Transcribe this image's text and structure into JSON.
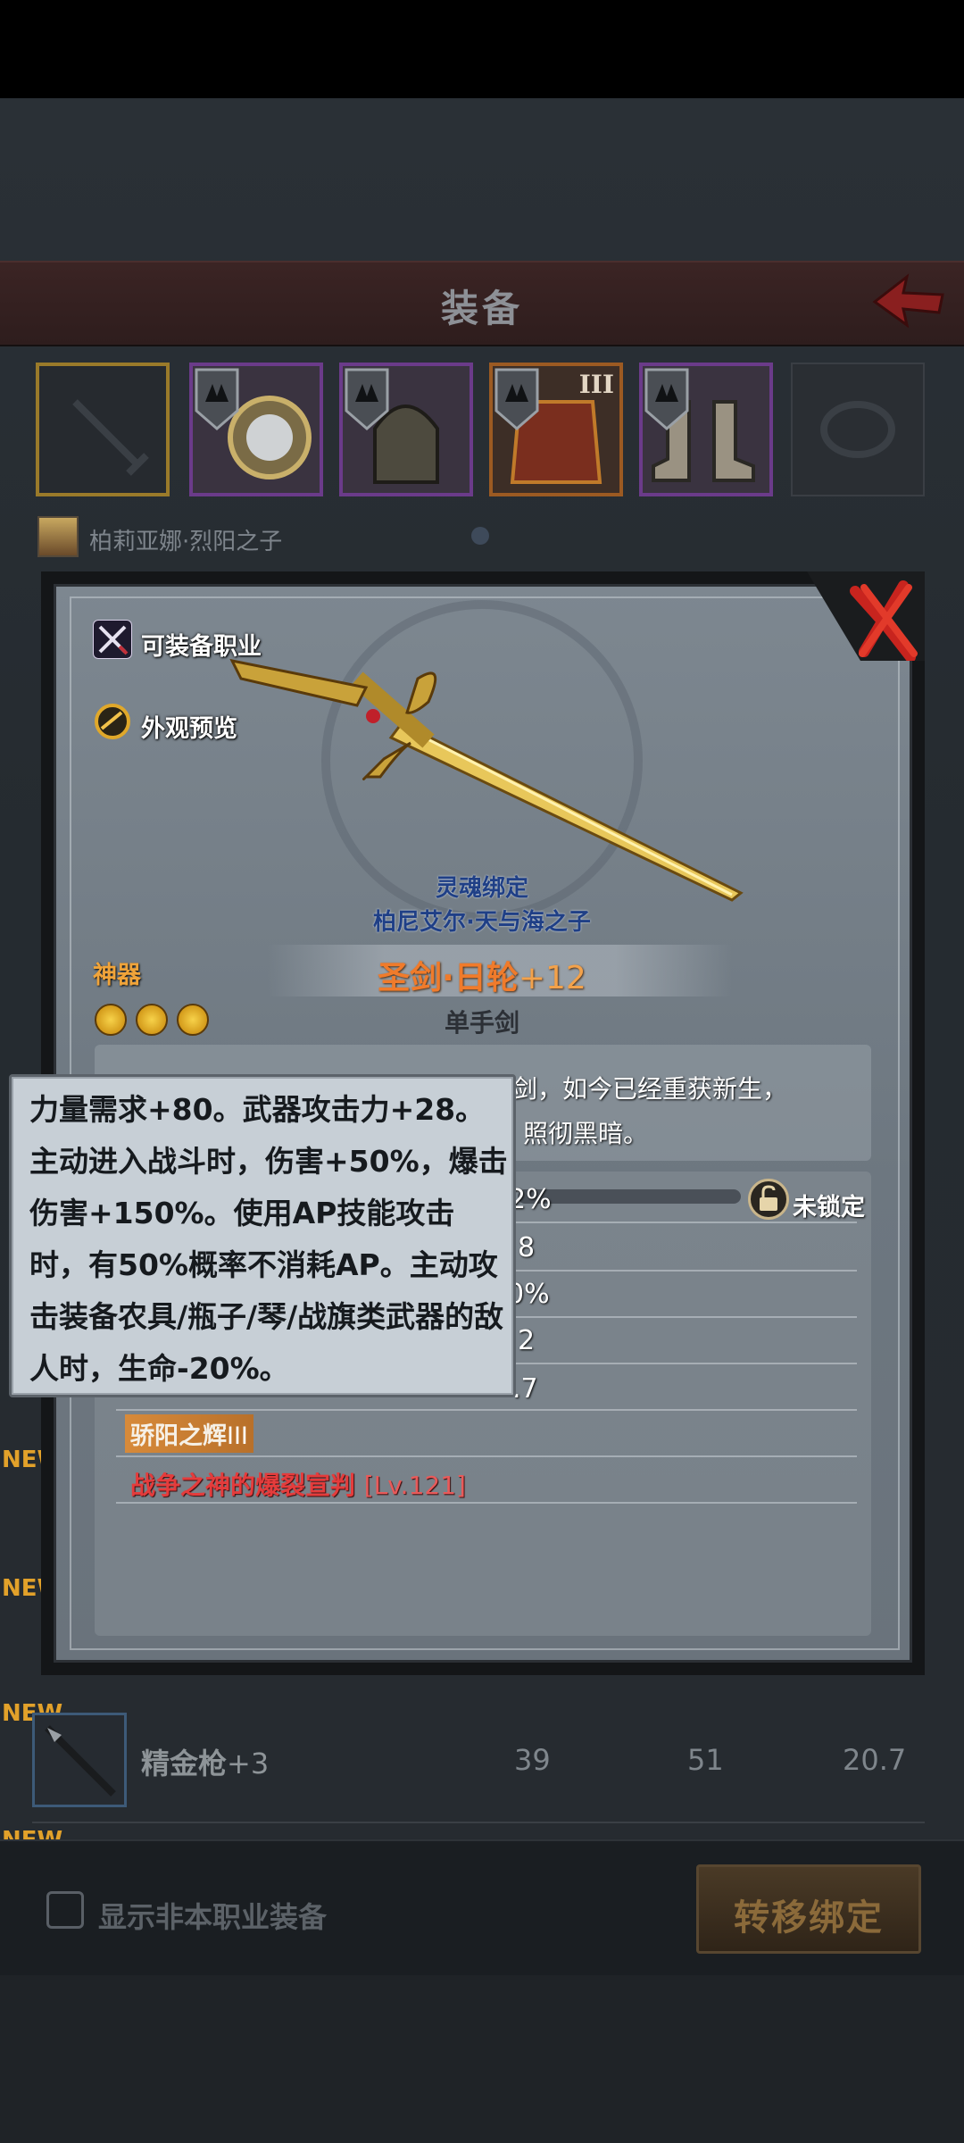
{
  "screen": {
    "title": "装备",
    "hero_name": "柏莉亚娜·烈阳之子"
  },
  "slots": [
    {
      "name": "empty-weapon-slot",
      "roman": ""
    },
    {
      "name": "amulet-slot",
      "roman": ""
    },
    {
      "name": "helmet-slot",
      "roman": ""
    },
    {
      "name": "armor-slot",
      "roman": "III"
    },
    {
      "name": "boots-slot",
      "roman": ""
    },
    {
      "name": "ring-slot",
      "roman": ""
    }
  ],
  "modal": {
    "equip_class_label": "可装备职业",
    "appearance_label": "外观预览",
    "soul_bound_label": "灵魂绑定",
    "bound_owner": "柏尼艾尔·天与海之子",
    "rarity": "神器",
    "item_name": "圣剑·日轮",
    "item_plus": "+12",
    "item_type": "单手剑",
    "desc_line1": "剑，如今已经重获新生，",
    "desc_line2": "照彻黑暗。",
    "stats": [
      "2%",
      "8",
      "0%",
      "2",
      ".7"
    ],
    "lock_label": "未锁定",
    "enchant": "骄阳之辉",
    "enchant_level": "III",
    "skill": "战争之神的爆裂宣判",
    "skill_level": "[Lv.121]"
  },
  "tooltip": {
    "text": "力量需求+80。武器攻击力+28。主动进入战斗时，伤害+50%，爆击伤害+150%。使用AP技能攻击时，有50%概率不消耗AP。主动攻击装备农具/瓶子/琴/战旗类武器的敌人时，生命-20%。"
  },
  "list": {
    "new_tags": [
      "NEW",
      "NEW",
      "NEW",
      "NEW"
    ],
    "item_name": "精金枪",
    "item_plus": "+3",
    "values": [
      "39",
      "51",
      "20.7"
    ]
  },
  "footer": {
    "show_other_class_label": "显示非本职业装备",
    "transfer_bind_label": "转移绑定"
  },
  "colors": {
    "rarity": "#f0a43a",
    "item_name": "#f07b2b",
    "skill": "#e43c3c",
    "soul_bound": "#1f3f86"
  }
}
